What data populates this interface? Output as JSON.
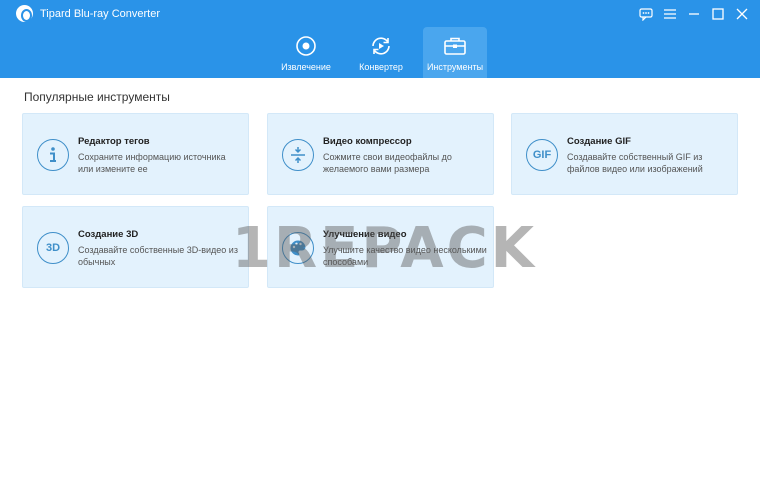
{
  "app": {
    "title": "Tipard Blu-ray Converter"
  },
  "nav": {
    "tabs": [
      {
        "label": "Извлечение",
        "icon": "disc-icon",
        "active": false
      },
      {
        "label": "Конвертер",
        "icon": "convert-icon",
        "active": false
      },
      {
        "label": "Инструменты",
        "icon": "toolbox-icon",
        "active": true
      }
    ]
  },
  "window_controls": [
    "feedback-icon",
    "menu-icon",
    "minimize-icon",
    "maximize-icon",
    "close-icon"
  ],
  "section": {
    "title": "Популярные инструменты"
  },
  "tools": [
    {
      "title": "Редактор тегов",
      "desc": "Сохраните информацию источника или измените ее",
      "icon": "info-icon"
    },
    {
      "title": "Видео компрессор",
      "desc": "Сожмите свои видеофайлы до желаемого вами размера",
      "icon": "compress-icon"
    },
    {
      "title": "Создание GIF",
      "desc": "Создавайте собственный GIF из файлов видео или изображений",
      "icon": "gif-icon",
      "icon_text": "GIF"
    },
    {
      "title": "Создание 3D",
      "desc": "Создавайте собственные 3D-видео из обычных",
      "icon": "3d-icon",
      "icon_text": "3D"
    },
    {
      "title": "Улучшение видео",
      "desc": "Улучшите качество видео несколькими способами",
      "icon": "palette-icon"
    }
  ],
  "watermark": "1REPACK",
  "colors": {
    "header": "#2a93e8",
    "active_tab": "#4aa6ee",
    "card_bg": "#e3f2fd",
    "icon": "#3f8fc9"
  }
}
